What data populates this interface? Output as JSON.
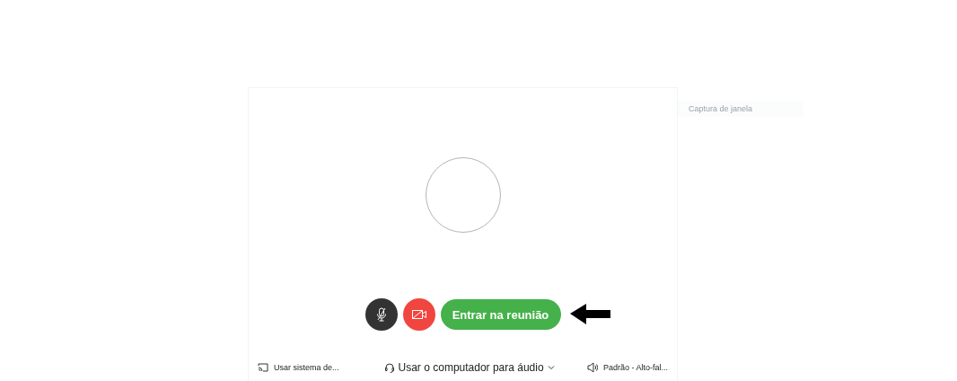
{
  "side_label": "Captura de janela",
  "controls": {
    "mic_muted": true,
    "camera_off": true,
    "join_button": "Entrar na reunião"
  },
  "footer": {
    "share": "Usar sistema de...",
    "audio": "Usar o computador para áudio",
    "speaker": "Padrão - Alto-fal..."
  }
}
